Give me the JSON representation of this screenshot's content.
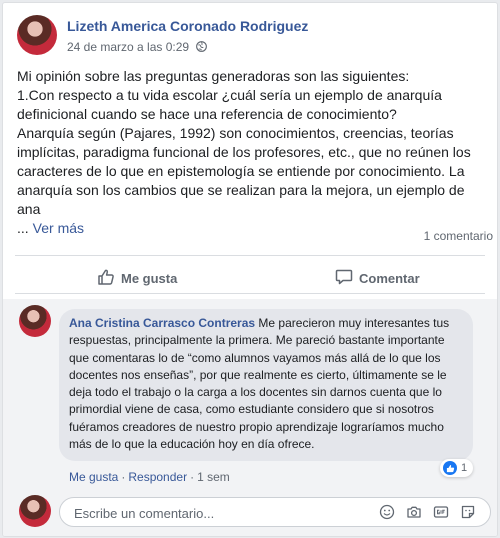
{
  "post": {
    "author_name": "Lizeth America Coronado Rodriguez",
    "timestamp": "24 de marzo a las 0:29",
    "privacy_icon": "globe-icon",
    "body_lines": [
      "Mi opinión sobre las preguntas generadoras son las siguientes:",
      "1.Con respecto a tu vida escolar ¿cuál sería un ejemplo de anarquía definicional cuando se hace una referencia de conocimiento?",
      "Anarquía según (Pajares, 1992) son conocimientos, creencias, teorías implícitas, paradigma funcional de los profesores, etc., que no reúnen los caracteres de lo que en epistemología se entiende por conocimiento. La anarquía son los cambios que se realizan para la mejora, un ejemplo de ana"
    ],
    "ellipsis": "...",
    "see_more": "Ver más",
    "comment_count": "1 comentario"
  },
  "actions": {
    "like_label": "Me gusta",
    "comment_label": "Comentar"
  },
  "comment": {
    "author_name": "Ana Cristina Carrasco Contreras",
    "text": "Me parecieron muy interesantes tus respuestas, principalmente la primera. Me pareció bastante importante que comentaras lo de “como alumnos vayamos más allá de lo que los docentes nos enseñas”, por que realmente es cierto, últimamente se le deja todo el trabajo o la carga a los docentes sin darnos cuenta que lo primordial viene de casa, como estudiante considero que si nosotros fuéramos creadores de nuestro propio aprendizaje lograríamos mucho más de lo que la educación hoy en día ofrece.",
    "reaction_count": "1",
    "like_link": "Me gusta",
    "reply_link": "Responder",
    "time": "1 sem"
  },
  "composer": {
    "placeholder": "Escribe un comentario...",
    "icons": [
      "emoji-icon",
      "camera-icon",
      "gif-icon",
      "sticker-icon"
    ]
  },
  "colors": {
    "link_blue": "#385898",
    "like_blue": "#1877f2",
    "muted_gray": "#606770",
    "comment_bg": "#f2f3f5"
  }
}
